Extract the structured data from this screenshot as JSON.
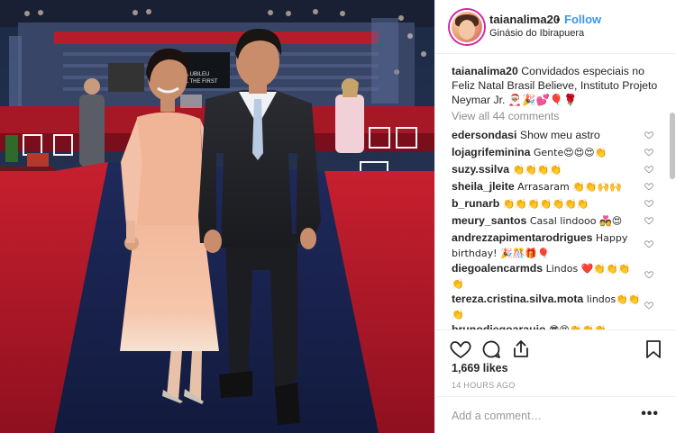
{
  "post": {
    "author": "taianalima20",
    "follow_label": "Follow",
    "dot": "•",
    "location": "Ginásio do Ibirapuera",
    "photo_banner_text": "JUBILEU\nALL THE FIRST",
    "caption_user": "taianalima20",
    "caption_text": "Convidados especiais no Feliz Natal Brasil Believe, Instituto Projeto Neymar Jr. 🎅🏽🎉💕🎈🌹",
    "view_all": "View all 44 comments",
    "likes": "1,669 likes",
    "time": "14 HOURS AGO",
    "add_placeholder": "Add a comment…",
    "more_label": "•••"
  },
  "comments": [
    {
      "user": "edersondasi",
      "text": "Show meu astro"
    },
    {
      "user": "lojagrifeminina",
      "text": "Gente😍😍😍👏"
    },
    {
      "user": "suzy.ssilva",
      "text": "👏👏👏👏"
    },
    {
      "user": "sheila_jleite",
      "text": "Arrasaram 👏👏🙌🙌"
    },
    {
      "user": "b_runarb",
      "text": "👏👏👏👏👏👏👏"
    },
    {
      "user": "meury_santos",
      "text": "Casal lindooo 💑😍"
    },
    {
      "user": "andrezzapimentarodrigues",
      "text": "Happy birthday! 🎉🎊🎁🎈"
    },
    {
      "user": "diegoalencarmds",
      "text": "Lindos ❤️👏👏👏👏"
    },
    {
      "user": "tereza.cristina.silva.mota",
      "text": "lindos👏👏👏"
    },
    {
      "user": "brunodiegoaraujo",
      "text": "😎😍👏👏👏"
    }
  ],
  "colors": {
    "accent": "#3897f0",
    "like_text": "#262626",
    "muted": "#8e8e8e"
  },
  "icons": [
    "heart-icon",
    "comment-icon",
    "share-icon",
    "bookmark-icon",
    "more-icon"
  ]
}
